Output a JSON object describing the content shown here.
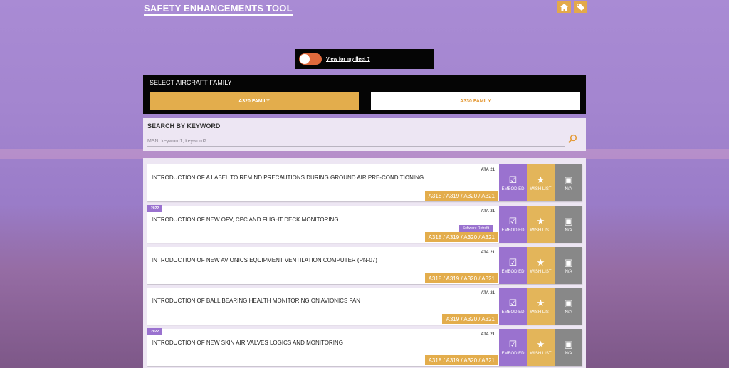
{
  "app": {
    "title": "SAFETY ENHANCEMENTS TOOL"
  },
  "header_icons": [
    "home-icon",
    "tag-icon"
  ],
  "fleet": {
    "label": "View for my fleet ?",
    "toggle_on": false
  },
  "family": {
    "title": "SELECT AIRCRAFT FAMILY",
    "options": [
      {
        "label": "A320 FAMILY",
        "selected": true
      },
      {
        "label": "A330 FAMILY",
        "selected": false
      }
    ]
  },
  "search": {
    "title": "SEARCH BY KEYWORD",
    "placeholder": "MSN, keyword1, keyword2",
    "value": ""
  },
  "actions": {
    "embodied": "EMBODIED",
    "wish": "WISH LIST",
    "na": "N/A"
  },
  "colors": {
    "accent": "#9a72cf",
    "orange": "#e3ad4c",
    "grey": "#888888"
  },
  "items": [
    {
      "year": "",
      "title": "INTRODUCTION OF A LABEL TO REMIND PRECAUTIONS DURING GROUND AIR PRE-CONDITIONING",
      "ata": "ATA 21",
      "tag": "",
      "aircraft": "A318 / A319 / A320 / A321"
    },
    {
      "year": "2022",
      "title": "INTRODUCTION OF NEW OFV, CPC AND FLIGHT DECK MONITORING",
      "ata": "ATA 21",
      "tag": "Software Retrofit",
      "aircraft": "A318 / A319 / A320 / A321"
    },
    {
      "year": "",
      "title": "INTRODUCTION OF NEW AVIONICS EQUIPMENT VENTILATION COMPUTER (PN-07)",
      "ata": "ATA 21",
      "tag": "",
      "aircraft": "A318 / A319 / A320 / A321"
    },
    {
      "year": "",
      "title": "INTRODUCTION OF BALL BEARING HEALTH MONITORING ON AVIONICS FAN",
      "ata": "ATA 21",
      "tag": "",
      "aircraft": "A319 / A320 / A321"
    },
    {
      "year": "2022",
      "title": "INTRODUCTION OF NEW SKIN AIR VALVES LOGICS AND MONITORING",
      "ata": "ATA 21",
      "tag": "",
      "aircraft": "A318 / A319 / A320 / A321"
    }
  ]
}
